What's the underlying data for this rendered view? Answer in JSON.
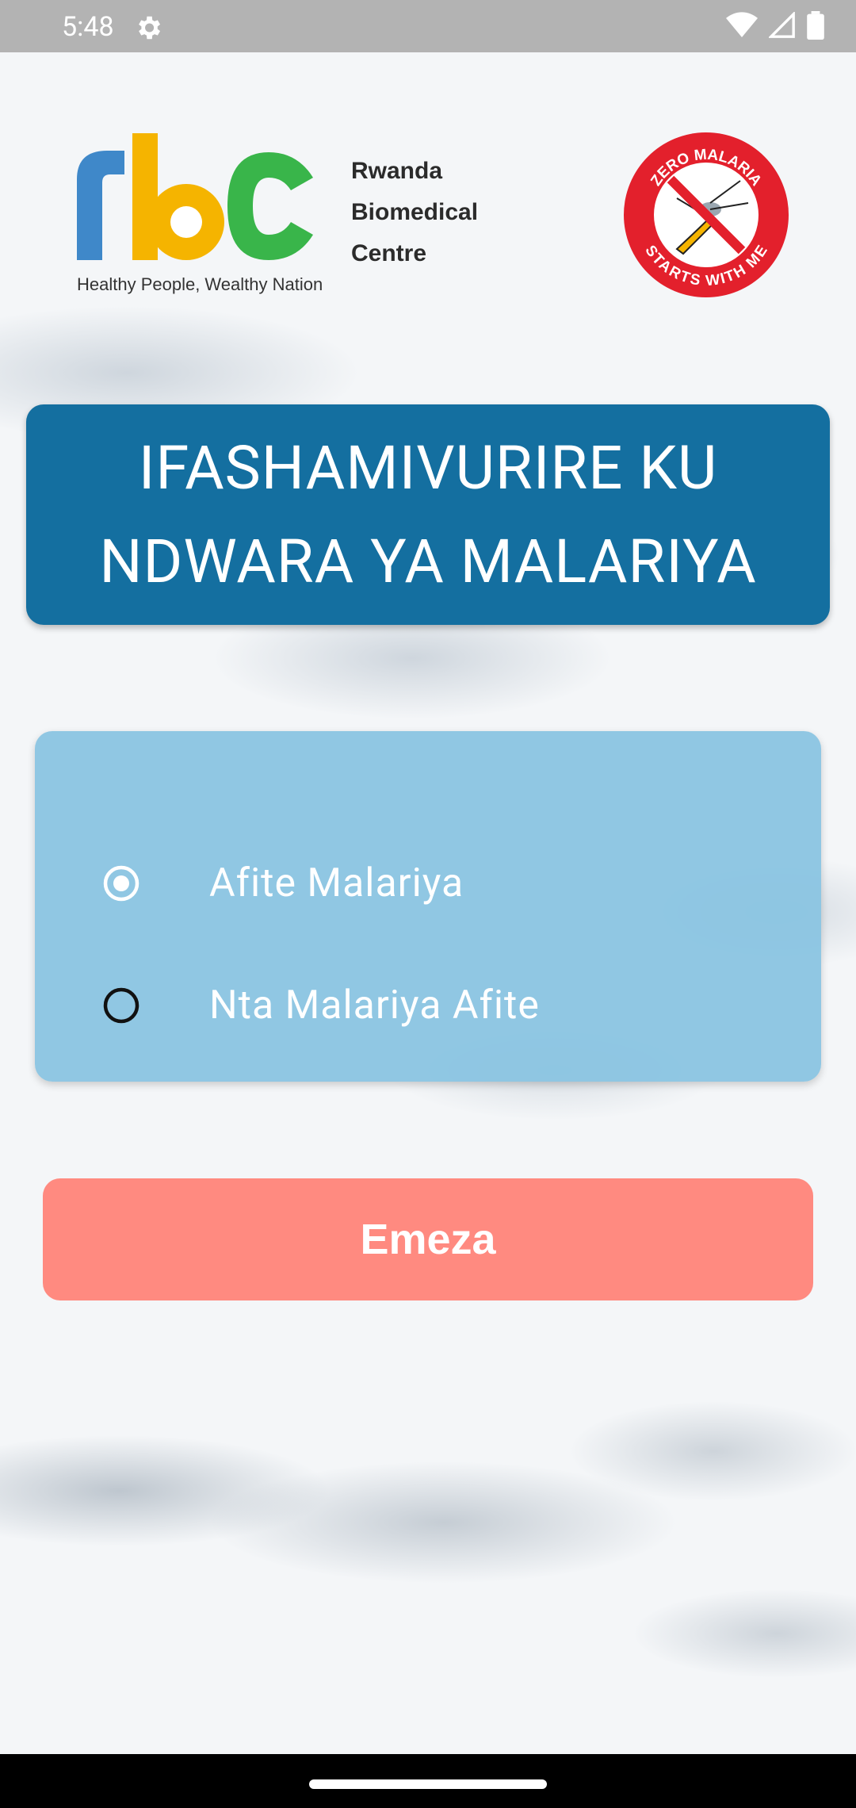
{
  "status_bar": {
    "time": "5:48",
    "icons": [
      "settings-icon",
      "wifi-icon",
      "signal-icon",
      "battery-icon"
    ]
  },
  "header": {
    "rbc_logo": {
      "letters": "rbc",
      "name_lines": [
        "Rwanda",
        "Biomedical",
        "Centre"
      ],
      "tagline": "Healthy People, Wealthy Nation",
      "colors": {
        "r": "#3f88c9",
        "b": "#f5b400",
        "c": "#39b54a"
      }
    },
    "zero_malaria_badge": {
      "top_text": "ZERO MALARIA",
      "bottom_text": "STARTS WITH ME",
      "color": "#e3202c"
    }
  },
  "title": {
    "line1": "IFASHAMIVURIRE KU",
    "line2": "NDWARA YA MALARIYA"
  },
  "options": [
    {
      "label": "Afite Malariya",
      "selected": true
    },
    {
      "label": "Nta Malariya Afite",
      "selected": false
    }
  ],
  "submit": {
    "label": "Emeza"
  },
  "colors": {
    "title_bg": "#146fa0",
    "options_bg": "#8ac4e1",
    "submit_bg": "#ff8a80",
    "status_bar_bg": "#b3b3b3"
  }
}
